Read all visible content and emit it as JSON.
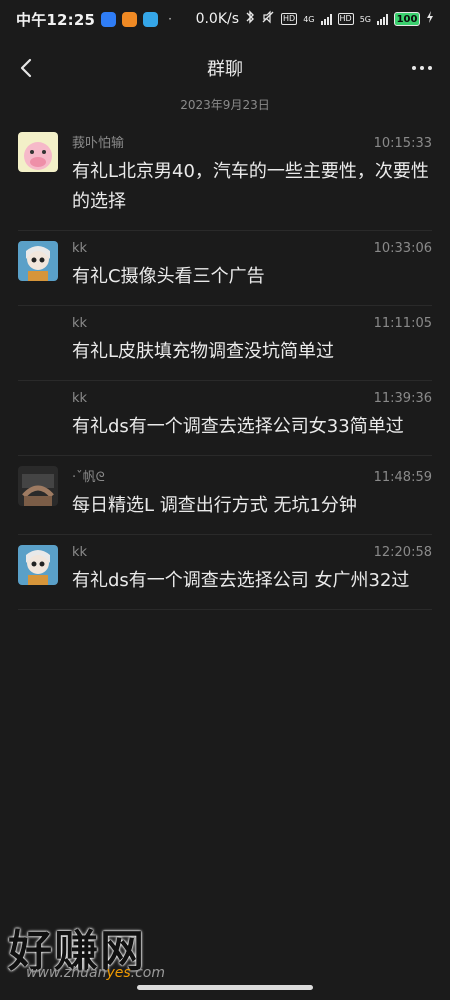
{
  "status_bar": {
    "time": "中午12:25",
    "net_speed": "0.0K/s",
    "battery": "100",
    "hd1": "HD",
    "hd2": "HD",
    "net1": "4G",
    "net2": "5G",
    "dot": "·"
  },
  "header": {
    "title": "群聊"
  },
  "date_divider": "2023年9月23日",
  "messages": [
    {
      "sender": "莪卟怕输",
      "time": "10:15:33",
      "content": "有礼L北京男40，汽车的一些主要性，次要性的选择",
      "avatar": "pink-cartoon-avatar"
    },
    {
      "sender": "kk",
      "time": "10:33:06",
      "content": "有礼C摄像头看三个广告",
      "avatar": "girl-avatar"
    },
    {
      "sender": "kk",
      "time": "11:11:05",
      "content": "有礼L皮肤填充物调查没坑简单过"
    },
    {
      "sender": "kk",
      "time": "11:39:36",
      "content": "有礼ds有一个调查去选择公司女33简单过"
    },
    {
      "sender": "·ˇ帆ᘓ",
      "time": "11:48:59",
      "content": "每日精选L 调查出行方式 无坑1分钟",
      "avatar": "car-avatar"
    },
    {
      "sender": "kk",
      "time": "12:20:58",
      "content": "有礼ds有一个调查去选择公司  女广州32过",
      "avatar": "girl-avatar"
    }
  ],
  "watermark": {
    "big": "好赚网",
    "small_prefix": "www.zhuan",
    "small_highlight": "yes",
    "small_suffix": ".com"
  },
  "colors": {
    "background": "#1b1b1b",
    "text": "#eaeaea",
    "muted": "#8a8a8a",
    "divider": "#2a2a2a"
  }
}
